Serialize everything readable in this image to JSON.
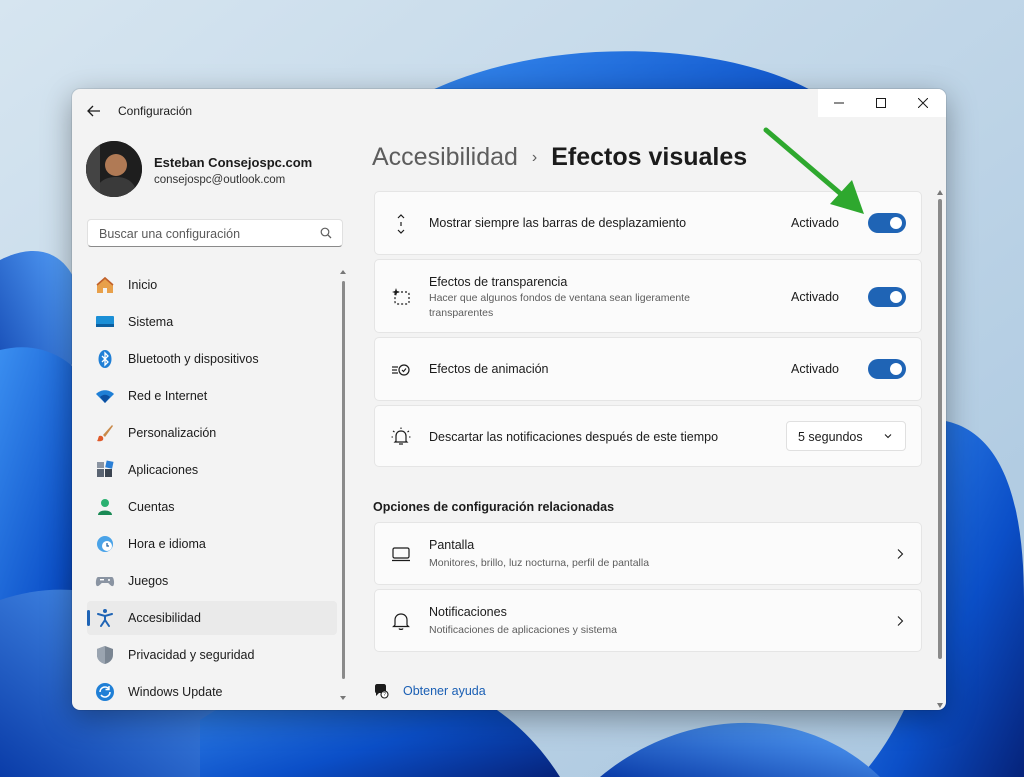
{
  "window": {
    "title": "Configuración"
  },
  "profile": {
    "name": "Esteban Consejospc.com",
    "email": "consejospc@outlook.com"
  },
  "search": {
    "placeholder": "Buscar una configuración"
  },
  "sidebar": {
    "items": [
      {
        "label": "Inicio",
        "icon": "home-icon"
      },
      {
        "label": "Sistema",
        "icon": "system-icon"
      },
      {
        "label": "Bluetooth y dispositivos",
        "icon": "bluetooth-icon"
      },
      {
        "label": "Red e Internet",
        "icon": "wifi-icon"
      },
      {
        "label": "Personalización",
        "icon": "brush-icon"
      },
      {
        "label": "Aplicaciones",
        "icon": "apps-icon"
      },
      {
        "label": "Cuentas",
        "icon": "account-icon"
      },
      {
        "label": "Hora e idioma",
        "icon": "clock-globe-icon"
      },
      {
        "label": "Juegos",
        "icon": "gamepad-icon"
      },
      {
        "label": "Accesibilidad",
        "icon": "accessibility-icon",
        "active": true
      },
      {
        "label": "Privacidad y seguridad",
        "icon": "shield-icon"
      },
      {
        "label": "Windows Update",
        "icon": "update-icon"
      }
    ]
  },
  "breadcrumb": {
    "parent": "Accesibilidad",
    "separator": "›",
    "current": "Efectos visuales"
  },
  "settings": [
    {
      "title": "Mostrar siempre las barras de desplazamiento",
      "state": "Activado",
      "on": true,
      "icon": "scrollbar-icon"
    },
    {
      "title": "Efectos de transparencia",
      "description": "Hacer que algunos fondos de ventana sean ligeramente transparentes",
      "state": "Activado",
      "on": true,
      "icon": "transparency-icon"
    },
    {
      "title": "Efectos de animación",
      "state": "Activado",
      "on": true,
      "icon": "animation-icon"
    },
    {
      "title": "Descartar las notificaciones después de este tiempo",
      "dropdown_value": "5 segundos",
      "icon": "notification-timer-icon"
    }
  ],
  "related": {
    "heading": "Opciones de configuración relacionadas",
    "items": [
      {
        "title": "Pantalla",
        "description": "Monitores, brillo, luz nocturna, perfil de pantalla",
        "icon": "display-icon"
      },
      {
        "title": "Notificaciones",
        "description": "Notificaciones de aplicaciones y sistema",
        "icon": "bell-icon"
      }
    ]
  },
  "help": {
    "label": "Obtener ayuda"
  },
  "colors": {
    "accent": "#1f64b5",
    "annotation_arrow": "#2ea82e"
  }
}
